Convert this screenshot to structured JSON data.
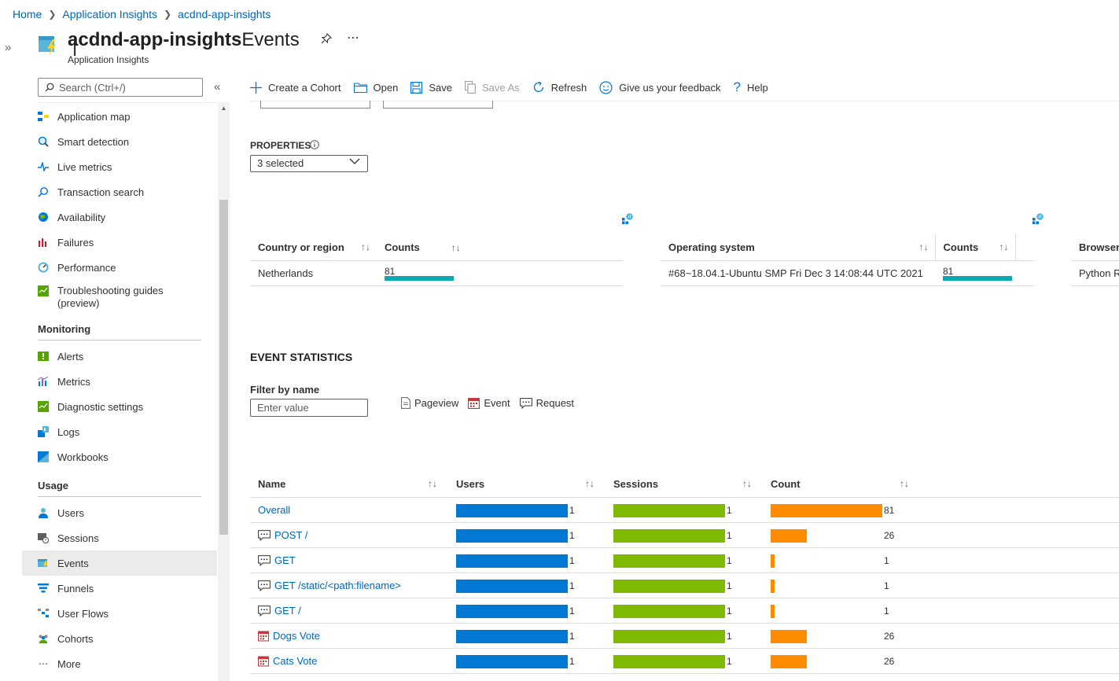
{
  "breadcrumb": [
    "Home",
    "Application Insights",
    "acdnd-app-insights"
  ],
  "header": {
    "resource_name": "acdnd-app-insights",
    "separator": "|",
    "blade": "Events",
    "subtitle": "Application Insights"
  },
  "sidebar": {
    "search_placeholder": "Search (Ctrl+/)",
    "items_top": [
      {
        "label": "Application map",
        "icon": "application-map-icon"
      },
      {
        "label": "Smart detection",
        "icon": "smart-detection-icon"
      },
      {
        "label": "Live metrics",
        "icon": "live-metrics-icon"
      },
      {
        "label": "Transaction search",
        "icon": "transaction-search-icon"
      },
      {
        "label": "Availability",
        "icon": "availability-icon"
      },
      {
        "label": "Failures",
        "icon": "failures-icon"
      },
      {
        "label": "Performance",
        "icon": "performance-icon"
      },
      {
        "label": "Troubleshooting guides",
        "label2": "(preview)",
        "icon": "troubleshooting-icon"
      }
    ],
    "group_monitoring": "Monitoring",
    "items_monitoring": [
      {
        "label": "Alerts"
      },
      {
        "label": "Metrics"
      },
      {
        "label": "Diagnostic settings"
      },
      {
        "label": "Logs"
      },
      {
        "label": "Workbooks"
      }
    ],
    "group_usage": "Usage",
    "items_usage": [
      {
        "label": "Users"
      },
      {
        "label": "Sessions"
      },
      {
        "label": "Events"
      },
      {
        "label": "Funnels"
      },
      {
        "label": "User Flows"
      },
      {
        "label": "Cohorts"
      },
      {
        "label": "More"
      }
    ]
  },
  "toolbar": {
    "create_cohort": "Create a Cohort",
    "open": "Open",
    "save": "Save",
    "save_as": "Save As",
    "refresh": "Refresh",
    "feedback": "Give us your feedback",
    "help": "Help"
  },
  "properties": {
    "label": "PROPERTIES",
    "selected": "3 selected"
  },
  "country_table": {
    "col1": "Country or region",
    "col2": "Counts",
    "rows": [
      {
        "name": "Netherlands",
        "count": "81",
        "fraction": 1.0
      }
    ]
  },
  "os_table": {
    "col1": "Operating system",
    "col2": "Counts",
    "rows": [
      {
        "name": "#68~18.04.1-Ubuntu SMP Fri Dec 3 14:08:44 UTC 2021",
        "count": "81",
        "fraction": 1.0
      }
    ]
  },
  "browser_table": {
    "col1": "Browser",
    "rows": [
      {
        "name": "Python R"
      }
    ]
  },
  "event_statistics": {
    "title": "EVENT STATISTICS",
    "filter_label": "Filter by name",
    "filter_placeholder": "Enter value",
    "legend": {
      "pageview": "Pageview",
      "event": "Event",
      "request": "Request"
    },
    "columns": {
      "name": "Name",
      "users": "Users",
      "sessions": "Sessions",
      "count": "Count"
    },
    "rows": [
      {
        "name": "Overall",
        "type": "none",
        "users": "1",
        "sessions": "1",
        "count": "81",
        "count_fraction": 1.0
      },
      {
        "name": "POST /",
        "type": "request",
        "users": "1",
        "sessions": "1",
        "count": "26",
        "count_fraction": 0.321
      },
      {
        "name": "GET",
        "type": "request",
        "users": "1",
        "sessions": "1",
        "count": "1",
        "count_fraction": 0.0123
      },
      {
        "name": "GET /static/<path:filename>",
        "type": "request",
        "users": "1",
        "sessions": "1",
        "count": "1",
        "count_fraction": 0.0123
      },
      {
        "name": "GET /",
        "type": "request",
        "users": "1",
        "sessions": "1",
        "count": "1",
        "count_fraction": 0.0123
      },
      {
        "name": "Dogs Vote",
        "type": "event",
        "users": "1",
        "sessions": "1",
        "count": "26",
        "count_fraction": 0.321
      },
      {
        "name": "Cats Vote",
        "type": "event",
        "users": "1",
        "sessions": "1",
        "count": "26",
        "count_fraction": 0.321
      }
    ]
  },
  "colors": {
    "accent": "#0078d4",
    "users_bar": "#0078d4",
    "sessions_bar": "#7fba00",
    "count_bar": "#ff8c00",
    "property_bar": "#0aa8b5"
  }
}
